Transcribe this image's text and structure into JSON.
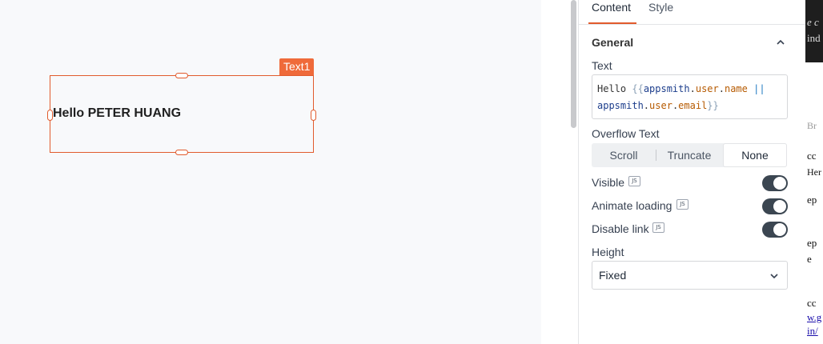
{
  "canvas": {
    "widget_tag": "Text1",
    "widget_text": "Hello PETER HUANG"
  },
  "tabs": {
    "content": "Content",
    "style": "Style"
  },
  "section": {
    "title": "General"
  },
  "text_field": {
    "label": "Text",
    "code": {
      "hello": "Hello ",
      "open": "{{",
      "obj1": "appsmith",
      "dot1": ".",
      "mid1": "user",
      "dot2": ".",
      "prop1": "name",
      "op": " ||",
      "obj2": "appsmith",
      "dot3": ".",
      "mid2": "user",
      "dot4": ".",
      "prop2": "email",
      "close": "}}"
    }
  },
  "overflow": {
    "label": "Overflow Text",
    "options": [
      "Scroll",
      "Truncate",
      "None"
    ],
    "selected": "None"
  },
  "js_badge": "JS",
  "visible": {
    "label": "Visible",
    "on": true
  },
  "animate_loading": {
    "label": "Animate loading",
    "on": true
  },
  "disable_link": {
    "label": "Disable link",
    "on": true
  },
  "height": {
    "label": "Height",
    "value": "Fixed"
  },
  "edge": {
    "frags": [
      "e c",
      "ind",
      "Br",
      "cc",
      "Her",
      "ep",
      "ep",
      "e",
      "cc",
      "w.g",
      "in/"
    ]
  },
  "colors": {
    "accent": "#e15b2d",
    "toggle_on": "#3b4651"
  }
}
